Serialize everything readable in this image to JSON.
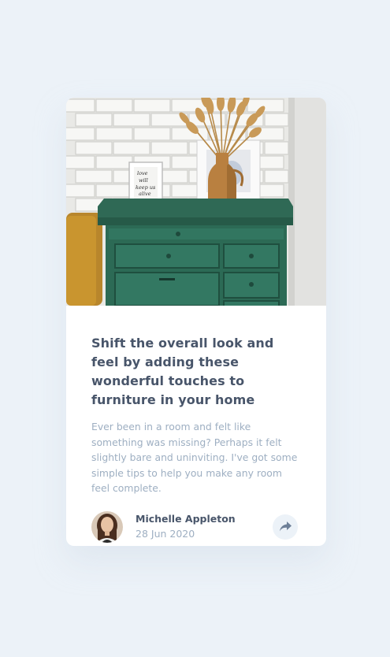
{
  "article": {
    "title": "Shift the overall look and feel by adding these wonderful touches to furniture in your home",
    "excerpt": "Ever been in a room and felt like something was missing? Perhaps it felt slightly bare and uninviting. I've got some simple tips to help you make any room feel complete.",
    "image_alt": "Green drawers with a vase of dried flowers and framed prints",
    "frame_text": [
      "love",
      "will",
      "keep us",
      "alive"
    ]
  },
  "author": {
    "name": "Michelle Appleton",
    "date": "28 Jun 2020"
  },
  "share": {
    "icon": "share-icon",
    "aria_label": "Share"
  },
  "colors": {
    "background": "#ecf2f8",
    "card": "#ffffff",
    "title": "#48556a",
    "text": "#9eafc2",
    "share_bg": "#ecf2f8",
    "share_icon": "#6e8098"
  }
}
